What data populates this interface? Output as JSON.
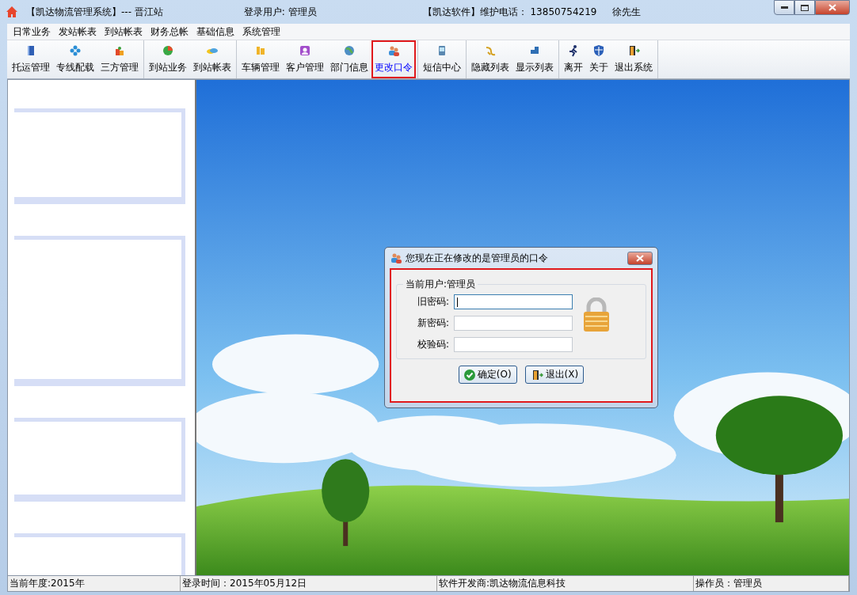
{
  "window": {
    "title": "【凯达物流管理系统】--- 晋江站",
    "login_user": "登录用户: 管理员",
    "support": "【凯达软件】维护电话： 13850754219",
    "contact": "徐先生"
  },
  "menu": [
    "日常业务",
    "发站帐表",
    "到站帐表",
    "财务总帐",
    "基础信息",
    "系统管理"
  ],
  "toolbar": [
    [
      {
        "label": "托运管理",
        "selected": false
      },
      {
        "label": "专线配载",
        "selected": false
      },
      {
        "label": "三方管理",
        "selected": false
      }
    ],
    [
      {
        "label": "到站业务",
        "selected": false
      },
      {
        "label": "到站帐表",
        "selected": false
      }
    ],
    [
      {
        "label": "车辆管理",
        "selected": false
      },
      {
        "label": "客户管理",
        "selected": false
      },
      {
        "label": "部门信息",
        "selected": false
      },
      {
        "label": "更改口令",
        "selected": true
      }
    ],
    [
      {
        "label": "短信中心",
        "selected": false
      }
    ],
    [
      {
        "label": "隐藏列表",
        "selected": false
      },
      {
        "label": "显示列表",
        "selected": false
      }
    ],
    [
      {
        "label": "离开",
        "selected": false
      },
      {
        "label": "关于",
        "selected": false
      },
      {
        "label": "退出系统",
        "selected": false
      }
    ]
  ],
  "dialog": {
    "title": "您现在正在修改的是管理员的口令",
    "highlighted": true,
    "group": "当前用户:管理员",
    "fields": [
      {
        "label": "旧密码:",
        "focused": true
      },
      {
        "label": "新密码:",
        "focused": false
      },
      {
        "label": "校验码:",
        "focused": false
      }
    ],
    "buttons": [
      {
        "kind": "ok",
        "label": "确定(O)"
      },
      {
        "kind": "exit",
        "label": "退出(X)"
      }
    ]
  },
  "status_bar": [
    "当前年度:2015年",
    "登录时间：2015年05月12日",
    "软件开发商:凯达物流信息科技",
    "操作员：管理员"
  ]
}
